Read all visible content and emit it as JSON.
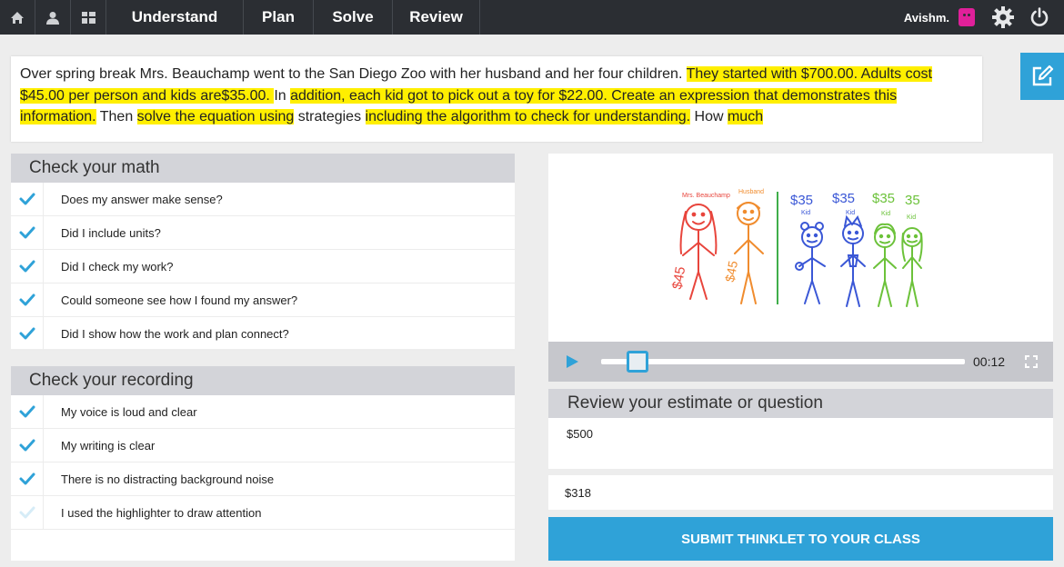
{
  "nav": {
    "tabs": [
      {
        "label": "Understand"
      },
      {
        "label": "Plan"
      },
      {
        "label": "Solve"
      },
      {
        "label": "Review"
      }
    ],
    "username": "Avishm."
  },
  "problem": {
    "segments": [
      {
        "text": "Over spring break Mrs. Beauchamp went to the San Diego Zoo with her husband and her four children. ",
        "highlight": false
      },
      {
        "text": "They started with $700.00. Adults cost $45.00 per person and kids are$35.00. ",
        "highlight": true
      },
      {
        "text": "In ",
        "highlight": false
      },
      {
        "text": "addition, each kid got to pick out a toy for $22.00. Create an expression that demonstrates this information.",
        "highlight": true
      },
      {
        "text": " Then ",
        "highlight": false
      },
      {
        "text": "solve the equation using",
        "highlight": true
      },
      {
        "text": " strategies ",
        "highlight": false
      },
      {
        "text": "including the algorithm to check for understanding.",
        "highlight": true
      },
      {
        "text": " How ",
        "highlight": false
      },
      {
        "text": "much",
        "highlight": true
      }
    ]
  },
  "check_math": {
    "title": "Check your math",
    "items": [
      {
        "label": "Does my answer make sense?",
        "checked": true
      },
      {
        "label": "Did I include units?",
        "checked": true
      },
      {
        "label": "Did I check my work?",
        "checked": true
      },
      {
        "label": "Could someone see how I found my answer?",
        "checked": true
      },
      {
        "label": "Did I show how the work and plan connect?",
        "checked": true
      }
    ]
  },
  "check_recording": {
    "title": "Check your recording",
    "items": [
      {
        "label": "My voice is loud and clear",
        "checked": true
      },
      {
        "label": "My writing is clear",
        "checked": true
      },
      {
        "label": "There is no distracting background noise",
        "checked": true
      },
      {
        "label": "I used the highlighter to draw attention",
        "checked": false
      }
    ]
  },
  "drawing": {
    "labels": {
      "mom": "Mrs. Beauchamp",
      "husband": "Husband",
      "mom_price": "$45",
      "husband_price": "$45",
      "kid_price_1": "$35",
      "kid_price_2": "$35",
      "kid_price_3": "$35",
      "kid_price_4": "35",
      "kid": "Kid"
    }
  },
  "player": {
    "time": "00:12",
    "progress": 0.07
  },
  "review": {
    "title": "Review your estimate or question",
    "estimate": "$500",
    "answer": "$318",
    "submit_label": "SUBMIT THINKLET TO YOUR CLASS"
  },
  "colors": {
    "accent": "#2fa2d8",
    "highlight": "#ffef00",
    "nav_bg": "#2b2e33",
    "check": "#2fa2d8",
    "check_unchecked": "#d6ecf7",
    "mom": "#e8453c",
    "husband": "#f08c2e",
    "kids_blue": "#3a57d6",
    "kids_green": "#6cc23a",
    "divider": "#3fae4a"
  }
}
